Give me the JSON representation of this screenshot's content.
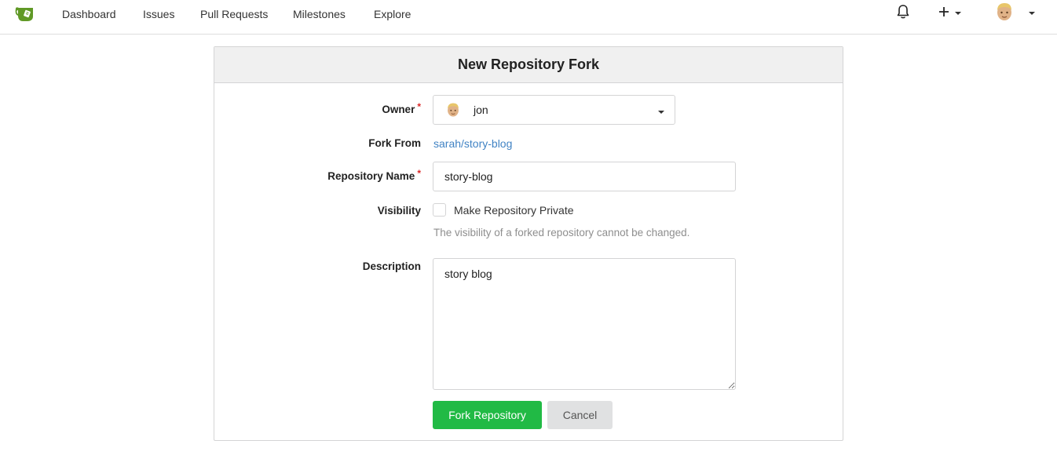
{
  "nav": {
    "items": [
      {
        "label": "Dashboard"
      },
      {
        "label": "Issues"
      },
      {
        "label": "Pull Requests"
      },
      {
        "label": "Milestones"
      },
      {
        "label": "Explore"
      }
    ],
    "icons": {
      "logo": "gitea-logo-icon",
      "notifications": "bell-icon",
      "create": "plus-icon",
      "user": "avatar-icon"
    }
  },
  "form": {
    "title": "New Repository Fork",
    "owner": {
      "label": "Owner",
      "required": "*",
      "value": "jon"
    },
    "fork_from": {
      "label": "Fork From",
      "value": "sarah/story-blog"
    },
    "repo_name": {
      "label": "Repository Name",
      "required": "*",
      "value": "story-blog"
    },
    "visibility": {
      "label": "Visibility",
      "checkbox_label": "Make Repository Private",
      "checked": false,
      "help": "The visibility of a forked repository cannot be changed."
    },
    "description": {
      "label": "Description",
      "value": "story blog"
    },
    "submit_label": "Fork Repository",
    "cancel_label": "Cancel"
  },
  "colors": {
    "primary": "#21ba45",
    "link": "#4183c4",
    "required": "#db2828",
    "logo": "#609926"
  }
}
